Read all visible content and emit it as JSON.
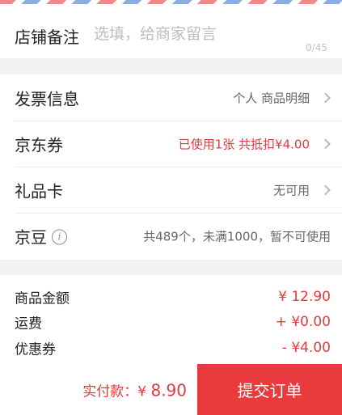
{
  "remark": {
    "label": "店铺备注",
    "placeholder": "选填，给商家留言",
    "count": "0/45"
  },
  "rows": [
    {
      "label": "发票信息",
      "value": "个人 商品明细"
    },
    {
      "label": "京东券",
      "value": "已使用1张 共抵扣¥4.00"
    },
    {
      "label": "礼品卡",
      "value": "无可用"
    },
    {
      "label": "京豆",
      "value": "共489个，未满1000，暂不可使用"
    }
  ],
  "info_icon": "i",
  "summary": [
    {
      "label": "商品金额",
      "value": "¥ 12.90"
    },
    {
      "label": "运费",
      "value": "+ ¥0.00"
    },
    {
      "label": "优惠券",
      "value": "- ¥4.00"
    }
  ],
  "footer": {
    "pay_label": "实付款：",
    "pay_currency": "¥ ",
    "pay_amount": "8.90",
    "submit_label": "提交订单"
  },
  "colors": {
    "accent": "#e4393c",
    "button": "#e93b3d"
  }
}
